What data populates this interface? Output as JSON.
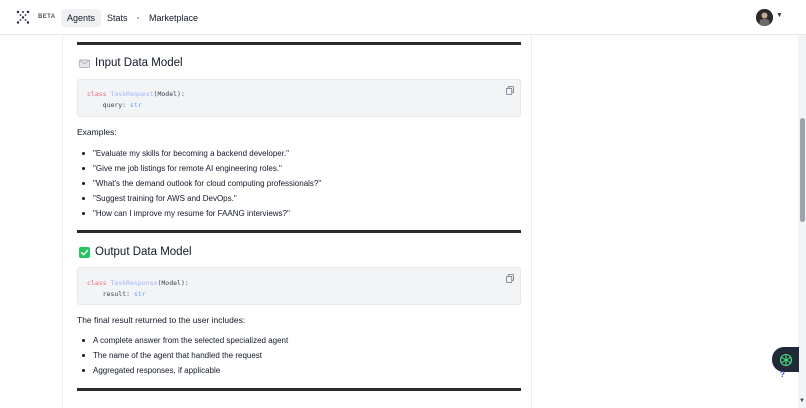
{
  "nav": {
    "beta": "BETA",
    "agents": "Agents",
    "stats": "Stats",
    "marketplace": "Marketplace"
  },
  "input_section": {
    "title": "Input Data Model",
    "icon": "envelope-icon",
    "code": {
      "kw": "class",
      "cls": "TaskRequest",
      "base": "(Model):",
      "field": "    query: ",
      "type": "str"
    },
    "examples_label": "Examples:",
    "examples": [
      "\"Evaluate my skills for becoming a backend developer.\"",
      "\"Give me job listings for remote AI engineering roles.\"",
      "\"What's the demand outlook for cloud computing professionals?\"",
      "\"Suggest training for AWS and DevOps.\"",
      "\"How can I improve my resume for FAANG interviews?\""
    ]
  },
  "output_section": {
    "title": "Output Data Model",
    "icon": "check-box-icon",
    "code": {
      "kw": "class",
      "cls": "TaskResponse",
      "base": "(Model):",
      "field": "    result: ",
      "type": "str"
    },
    "result_label": "The final result returned to the user includes:",
    "items": [
      "A complete answer from the selected specialized agent",
      "The name of the agent that handled the request",
      "Aggregated responses, if applicable"
    ]
  },
  "help_text": "?",
  "colors": {
    "rule": "#2b2b2b",
    "code_bg": "#f3f4f6",
    "check_green": "#22c55e",
    "keyword": "#e06c75",
    "type": "#60a5fa"
  }
}
